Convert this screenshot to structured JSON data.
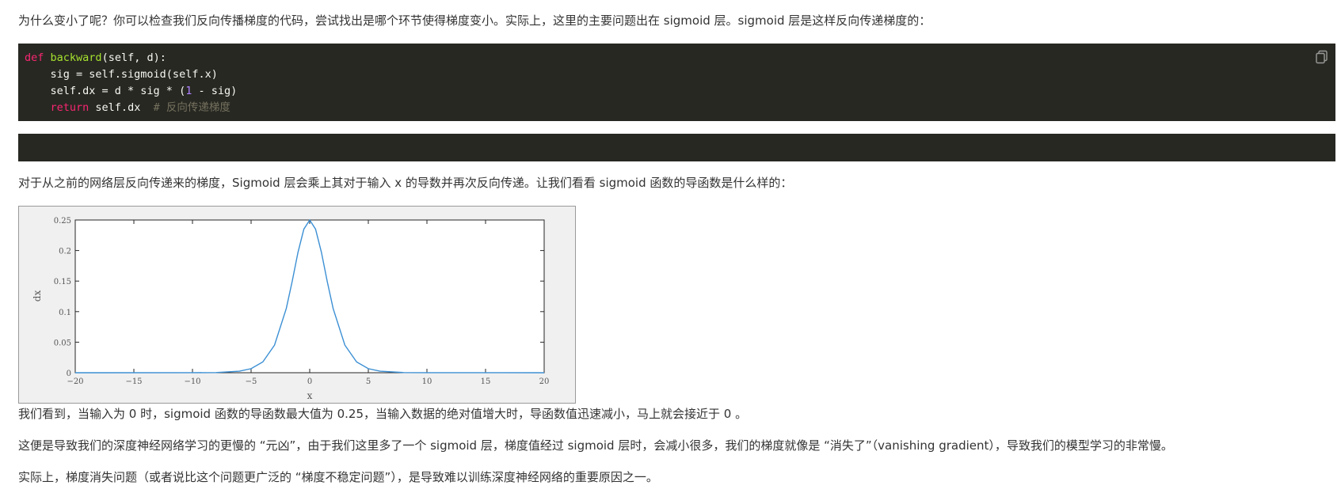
{
  "paragraphs": {
    "p1": "为什么变小了呢？你可以检查我们反向传播梯度的代码，尝试找出是哪个环节使得梯度变小。实际上，这里的主要问题出在 sigmoid 层。sigmoid 层是这样反向传递梯度的：",
    "p2": "对于从之前的网络层反向传递来的梯度，Sigmoid 层会乘上其对于输入 x 的导数并再次反向传递。让我们看看 sigmoid 函数的导函数是什么样的：",
    "p3": "我们看到，当输入为 0 时，sigmoid 函数的导函数最大值为 0.25，当输入数据的绝对值增大时，导函数值迅速减小，马上就会接近于 0 。",
    "p4": "这便是导致我们的深度神经网络学习的更慢的 “元凶”，由于我们这里多了一个 sigmoid 层，梯度值经过 sigmoid 层时，会减小很多，我们的梯度就像是 “消失了”（vanishing gradient），导致我们的模型学习的非常慢。",
    "p5": "实际上，梯度消失问题（或者说比这个问题更广泛的 “梯度不稳定问题”），是导致难以训练深度神经网络的重要原因之一。"
  },
  "code": {
    "l1_kw": "def",
    "l1_fn": "backward",
    "l1_rest": "(self, d):",
    "l2": "    sig = self.sigmoid(self.x)",
    "l3_a": "    self.dx = d * sig * (",
    "l3_num": "1",
    "l3_b": " - sig)",
    "l4_indent": "    ",
    "l4_kw": "return",
    "l4_rest": " self.dx  ",
    "l4_comment": "# 反向传递梯度",
    "copy_icon": "copy-icon"
  },
  "colors": {
    "code_bg": "#272822",
    "chart_line": "#3b8fd4",
    "chart_frame_bg": "#f0f0f0"
  },
  "chart_data": {
    "type": "line",
    "title": "",
    "xlabel": "x",
    "ylabel": "dx",
    "xlim": [
      -20,
      20
    ],
    "ylim": [
      0,
      0.25
    ],
    "xticks": [
      "-20",
      "-15",
      "-10",
      "-5",
      "0",
      "5",
      "10",
      "15",
      "20"
    ],
    "yticks": [
      "0",
      "0.05",
      "0.1",
      "0.15",
      "0.2",
      "0.25"
    ],
    "grid": false,
    "series": [
      {
        "x": [
          -20,
          -10,
          -8,
          -6,
          -5,
          -4,
          -3,
          -2,
          -1.5,
          -1,
          -0.5,
          0,
          0.5,
          1,
          1.5,
          2,
          3,
          4,
          5,
          6,
          8,
          10,
          20
        ],
        "y": [
          0,
          5e-05,
          0.0003,
          0.0025,
          0.0066,
          0.0177,
          0.0452,
          0.105,
          0.149,
          0.197,
          0.235,
          0.25,
          0.235,
          0.197,
          0.149,
          0.105,
          0.0452,
          0.0177,
          0.0066,
          0.0025,
          0.0003,
          5e-05,
          0
        ]
      }
    ]
  }
}
